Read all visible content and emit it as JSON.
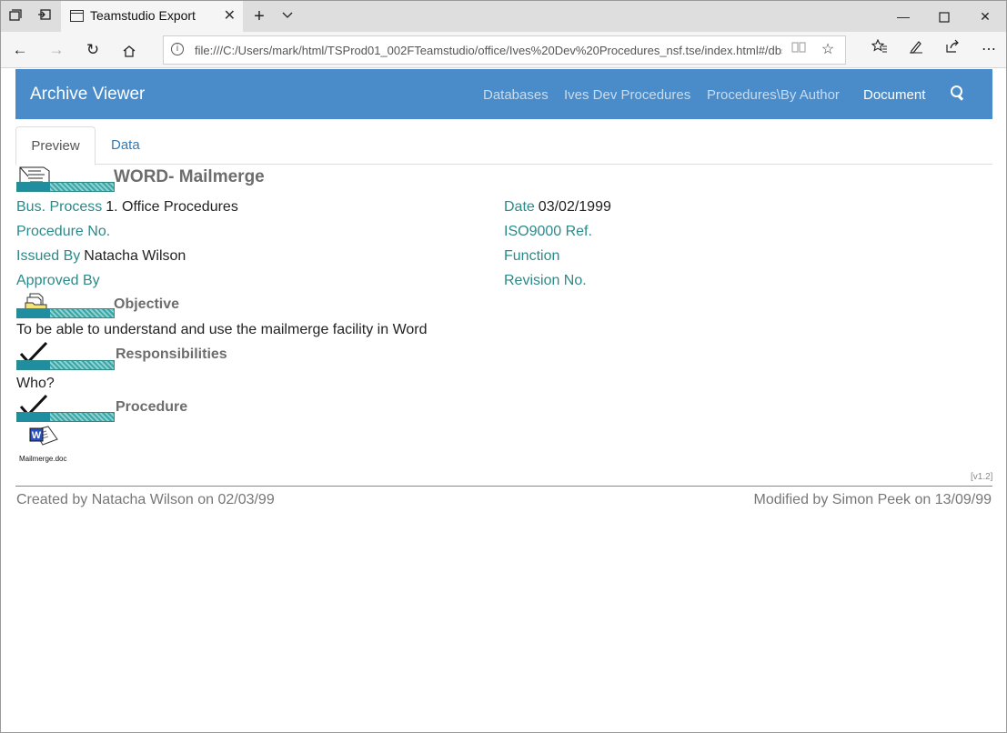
{
  "browser": {
    "tab_title": "Teamstudio Export",
    "url": "file:///C:/Users/mark/html/TSProd01_002FTeamstudio/office/Ives%20Dev%20Procedures_nsf.tse/index.html#/dbs"
  },
  "app": {
    "brand": "Archive Viewer",
    "nav": [
      "Databases",
      "Ives Dev Procedures",
      "Procedures\\By Author",
      "Document"
    ],
    "active_nav": "Document"
  },
  "tabs": {
    "preview": "Preview",
    "data": "Data"
  },
  "doc": {
    "title": "WORD- Mailmerge",
    "fields": {
      "bus_process_label": "Bus. Process",
      "bus_process_value": "1. Office Procedures",
      "date_label": "Date",
      "date_value": "03/02/1999",
      "procedure_no_label": "Procedure No.",
      "iso_label": "ISO9000 Ref.",
      "issued_by_label": "Issued By",
      "issued_by_value": "Natacha Wilson",
      "function_label": "Function",
      "approved_by_label": "Approved By",
      "revision_label": "Revision No."
    },
    "sections": {
      "objective": "Objective",
      "objective_text": "To be able to understand and use the mailmerge facility in Word",
      "responsibilities": "Responsibilities",
      "responsibilities_text": "Who?",
      "procedure": "Procedure"
    },
    "attachment": "Mailmerge.doc"
  },
  "footer": {
    "version": "[v1.2]",
    "created": "Created by Natacha Wilson on 02/03/99",
    "modified": "Modified by Simon Peek on 13/09/99"
  },
  "icons": [
    "tab-list-icon",
    "set-aside-icon",
    "new-tab-icon",
    "tab-dropdown-icon",
    "back-icon",
    "forward-icon",
    "refresh-icon",
    "home-icon",
    "info-icon",
    "reading-view-icon",
    "favorite-icon",
    "favorites-hub-icon",
    "pen-icon",
    "share-icon",
    "more-icon",
    "search-icon",
    "checkmark-icon",
    "folder-icon",
    "word-doc-icon"
  ]
}
